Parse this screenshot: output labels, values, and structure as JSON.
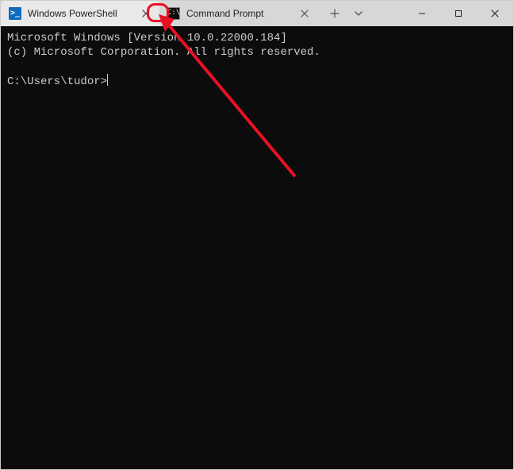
{
  "tabs": [
    {
      "label": "Windows PowerShell",
      "icon": "powershell-icon",
      "active": true
    },
    {
      "label": "Command Prompt",
      "icon": "cmd-icon",
      "active": false
    }
  ],
  "terminal": {
    "line1": "Microsoft Windows [Version 10.0.22000.184]",
    "line2": "(c) Microsoft Corporation. All rights reserved.",
    "blank": "",
    "prompt": "C:\\Users\\tudor>"
  },
  "annotation": {
    "target": "tab-close-powershell"
  }
}
